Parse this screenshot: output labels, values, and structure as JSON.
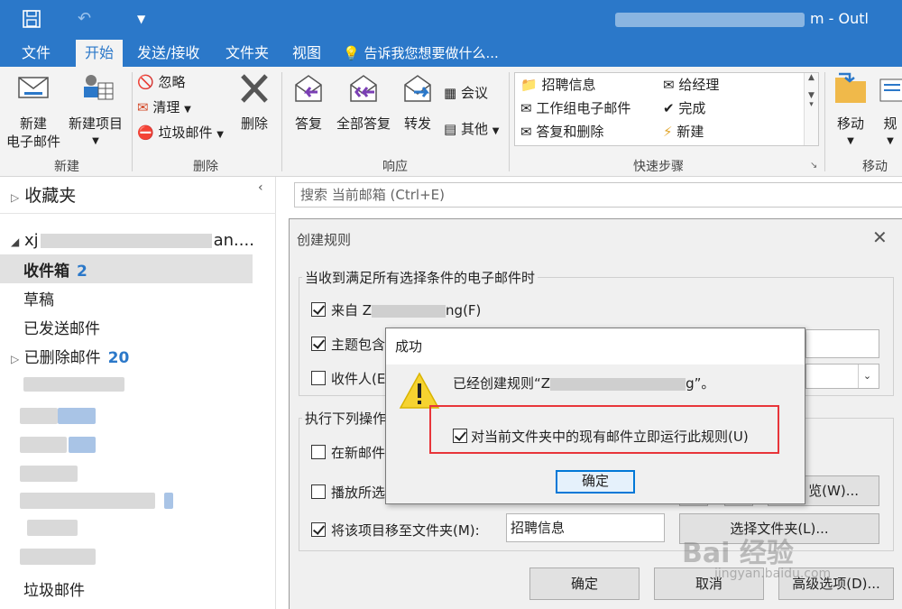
{
  "titlebar": {
    "title_suffix": "m - Outl"
  },
  "menu": {
    "tabs": [
      "文件",
      "开始",
      "发送/接收",
      "文件夹",
      "视图"
    ],
    "tell_me": "告诉我您想要做什么..."
  },
  "ribbon": {
    "new_email": [
      "新建",
      "电子邮件"
    ],
    "new_items": "新建项目",
    "group_new": "新建",
    "ignore": "忽略",
    "clean": "清理",
    "junk": "垃圾邮件",
    "delete": "删除",
    "group_delete": "删除",
    "reply": "答复",
    "reply_all": "全部答复",
    "forward": "转发",
    "meeting": "会议",
    "other": "其他",
    "group_respond": "响应",
    "quicksteps": [
      "招聘信息",
      "工作组电子邮件",
      "答复和删除",
      "给经理",
      "完成",
      "新建"
    ],
    "group_quicksteps": "快速步骤",
    "move": "移动",
    "rules": "规",
    "group_move": "移动"
  },
  "folders": {
    "favorites": "收藏夹",
    "account_suffix": "an....",
    "inbox": "收件箱",
    "inbox_count": "2",
    "drafts": "草稿",
    "sent": "已发送邮件",
    "deleted": "已删除邮件",
    "deleted_count": "20",
    "junk": "垃圾邮件"
  },
  "search": {
    "placeholder": "搜索 当前邮箱 (Ctrl+E)"
  },
  "rule_dialog": {
    "title": "创建规则",
    "conditions_legend": "当收到满足所有选择条件的电子邮件时",
    "from_prefix": "来自 Z",
    "from_suffix": "ng(F)",
    "subject_label": "主题包含",
    "recipient_label": "收件人(E",
    "actions_legend": "执行下列操作",
    "new_mail_label": "在新邮件",
    "play_label": "播放所选",
    "browse_btn": "览(W)...",
    "move_label": "将该项目移至文件夹(M):",
    "move_folder": "招聘信息",
    "select_folder_btn": "选择文件夹(L)...",
    "ok": "确定",
    "cancel": "取消",
    "advanced": "高级选项(D)..."
  },
  "success_dialog": {
    "title": "成功",
    "message_prefix": "已经创建规则“Z",
    "message_suffix": "g”。",
    "run_now": "对当前文件夹中的现有邮件立即运行此规则(U)",
    "ok": "确定"
  },
  "watermark": {
    "brand": "Bai 经验",
    "url": "jingyan.baidu.com"
  },
  "colors": {
    "accent": "#2b78c9",
    "highlight": "#e8353a"
  }
}
